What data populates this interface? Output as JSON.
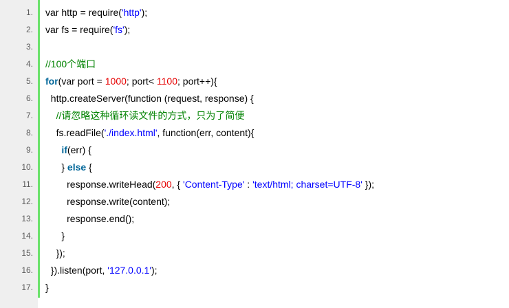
{
  "colors": {
    "gutter_bg": "#efefef",
    "gutter_rule": "#6ce26c",
    "line_number": "#5c5c5c",
    "plain": "#000000",
    "string": "#0000ff",
    "number": "#e60000",
    "keyword": "#006699",
    "comment": "#008200"
  },
  "code": {
    "lines": [
      {
        "number": "1.",
        "indent": "",
        "tokens": [
          {
            "type": "plain",
            "text": "var http = require("
          },
          {
            "type": "string",
            "text": "'http'"
          },
          {
            "type": "plain",
            "text": ");"
          }
        ]
      },
      {
        "number": "2.",
        "indent": "",
        "tokens": [
          {
            "type": "plain",
            "text": "var fs = require("
          },
          {
            "type": "string",
            "text": "'fs'"
          },
          {
            "type": "plain",
            "text": ");"
          }
        ]
      },
      {
        "number": "3.",
        "indent": "",
        "tokens": []
      },
      {
        "number": "4.",
        "indent": "",
        "tokens": [
          {
            "type": "comment",
            "text": "//100个端口"
          }
        ]
      },
      {
        "number": "5.",
        "indent": "",
        "tokens": [
          {
            "type": "keyword",
            "text": "for"
          },
          {
            "type": "plain",
            "text": "(var port = "
          },
          {
            "type": "number",
            "text": "1000"
          },
          {
            "type": "plain",
            "text": "; port< "
          },
          {
            "type": "number",
            "text": "1100"
          },
          {
            "type": "plain",
            "text": "; port++){"
          }
        ]
      },
      {
        "number": "6.",
        "indent": "  ",
        "tokens": [
          {
            "type": "plain",
            "text": "http.createServer(function (request, response) {"
          }
        ]
      },
      {
        "number": "7.",
        "indent": "    ",
        "tokens": [
          {
            "type": "comment",
            "text": "//请忽略这种循环读文件的方式，只为了简便"
          }
        ]
      },
      {
        "number": "8.",
        "indent": "    ",
        "tokens": [
          {
            "type": "plain",
            "text": "fs.readFile("
          },
          {
            "type": "string",
            "text": "'./index.html'"
          },
          {
            "type": "plain",
            "text": ", function(err, content){"
          }
        ]
      },
      {
        "number": "9.",
        "indent": "      ",
        "tokens": [
          {
            "type": "keyword",
            "text": "if"
          },
          {
            "type": "plain",
            "text": "(err) {"
          }
        ]
      },
      {
        "number": "10.",
        "indent": "      ",
        "tokens": [
          {
            "type": "plain",
            "text": "} "
          },
          {
            "type": "keyword",
            "text": "else"
          },
          {
            "type": "plain",
            "text": " {"
          }
        ]
      },
      {
        "number": "11.",
        "indent": "        ",
        "tokens": [
          {
            "type": "plain",
            "text": "response.writeHead("
          },
          {
            "type": "number",
            "text": "200"
          },
          {
            "type": "plain",
            "text": ", { "
          },
          {
            "type": "string",
            "text": "'Content-Type'"
          },
          {
            "type": "plain",
            "text": " : "
          },
          {
            "type": "string",
            "text": "'text/html; charset=UTF-8'"
          },
          {
            "type": "plain",
            "text": " });"
          }
        ]
      },
      {
        "number": "12.",
        "indent": "        ",
        "tokens": [
          {
            "type": "plain",
            "text": "response.write(content);"
          }
        ]
      },
      {
        "number": "13.",
        "indent": "        ",
        "tokens": [
          {
            "type": "plain",
            "text": "response.end();"
          }
        ]
      },
      {
        "number": "14.",
        "indent": "      ",
        "tokens": [
          {
            "type": "plain",
            "text": "}"
          }
        ]
      },
      {
        "number": "15.",
        "indent": "    ",
        "tokens": [
          {
            "type": "plain",
            "text": "});"
          }
        ]
      },
      {
        "number": "16.",
        "indent": "  ",
        "tokens": [
          {
            "type": "plain",
            "text": "}).listen(port, "
          },
          {
            "type": "string",
            "text": "'127.0.0.1'"
          },
          {
            "type": "plain",
            "text": ");"
          }
        ]
      },
      {
        "number": "17.",
        "indent": "",
        "tokens": [
          {
            "type": "plain",
            "text": "}"
          }
        ]
      }
    ]
  }
}
